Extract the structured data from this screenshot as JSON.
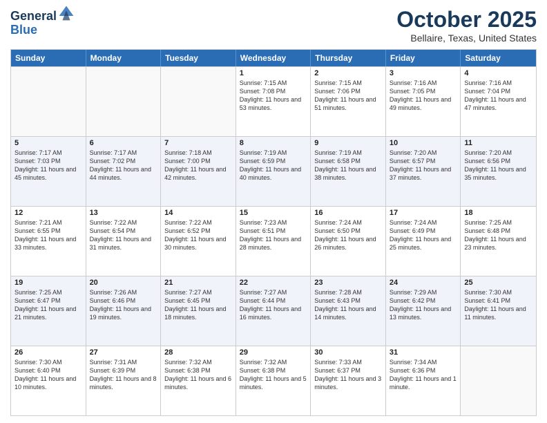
{
  "header": {
    "logo_line1": "General",
    "logo_line2": "Blue",
    "month": "October 2025",
    "location": "Bellaire, Texas, United States"
  },
  "weekdays": [
    "Sunday",
    "Monday",
    "Tuesday",
    "Wednesday",
    "Thursday",
    "Friday",
    "Saturday"
  ],
  "rows": [
    [
      {
        "day": "",
        "sunrise": "",
        "sunset": "",
        "daylight": ""
      },
      {
        "day": "",
        "sunrise": "",
        "sunset": "",
        "daylight": ""
      },
      {
        "day": "",
        "sunrise": "",
        "sunset": "",
        "daylight": ""
      },
      {
        "day": "1",
        "sunrise": "Sunrise: 7:15 AM",
        "sunset": "Sunset: 7:08 PM",
        "daylight": "Daylight: 11 hours and 53 minutes."
      },
      {
        "day": "2",
        "sunrise": "Sunrise: 7:15 AM",
        "sunset": "Sunset: 7:06 PM",
        "daylight": "Daylight: 11 hours and 51 minutes."
      },
      {
        "day": "3",
        "sunrise": "Sunrise: 7:16 AM",
        "sunset": "Sunset: 7:05 PM",
        "daylight": "Daylight: 11 hours and 49 minutes."
      },
      {
        "day": "4",
        "sunrise": "Sunrise: 7:16 AM",
        "sunset": "Sunset: 7:04 PM",
        "daylight": "Daylight: 11 hours and 47 minutes."
      }
    ],
    [
      {
        "day": "5",
        "sunrise": "Sunrise: 7:17 AM",
        "sunset": "Sunset: 7:03 PM",
        "daylight": "Daylight: 11 hours and 45 minutes."
      },
      {
        "day": "6",
        "sunrise": "Sunrise: 7:17 AM",
        "sunset": "Sunset: 7:02 PM",
        "daylight": "Daylight: 11 hours and 44 minutes."
      },
      {
        "day": "7",
        "sunrise": "Sunrise: 7:18 AM",
        "sunset": "Sunset: 7:00 PM",
        "daylight": "Daylight: 11 hours and 42 minutes."
      },
      {
        "day": "8",
        "sunrise": "Sunrise: 7:19 AM",
        "sunset": "Sunset: 6:59 PM",
        "daylight": "Daylight: 11 hours and 40 minutes."
      },
      {
        "day": "9",
        "sunrise": "Sunrise: 7:19 AM",
        "sunset": "Sunset: 6:58 PM",
        "daylight": "Daylight: 11 hours and 38 minutes."
      },
      {
        "day": "10",
        "sunrise": "Sunrise: 7:20 AM",
        "sunset": "Sunset: 6:57 PM",
        "daylight": "Daylight: 11 hours and 37 minutes."
      },
      {
        "day": "11",
        "sunrise": "Sunrise: 7:20 AM",
        "sunset": "Sunset: 6:56 PM",
        "daylight": "Daylight: 11 hours and 35 minutes."
      }
    ],
    [
      {
        "day": "12",
        "sunrise": "Sunrise: 7:21 AM",
        "sunset": "Sunset: 6:55 PM",
        "daylight": "Daylight: 11 hours and 33 minutes."
      },
      {
        "day": "13",
        "sunrise": "Sunrise: 7:22 AM",
        "sunset": "Sunset: 6:54 PM",
        "daylight": "Daylight: 11 hours and 31 minutes."
      },
      {
        "day": "14",
        "sunrise": "Sunrise: 7:22 AM",
        "sunset": "Sunset: 6:52 PM",
        "daylight": "Daylight: 11 hours and 30 minutes."
      },
      {
        "day": "15",
        "sunrise": "Sunrise: 7:23 AM",
        "sunset": "Sunset: 6:51 PM",
        "daylight": "Daylight: 11 hours and 28 minutes."
      },
      {
        "day": "16",
        "sunrise": "Sunrise: 7:24 AM",
        "sunset": "Sunset: 6:50 PM",
        "daylight": "Daylight: 11 hours and 26 minutes."
      },
      {
        "day": "17",
        "sunrise": "Sunrise: 7:24 AM",
        "sunset": "Sunset: 6:49 PM",
        "daylight": "Daylight: 11 hours and 25 minutes."
      },
      {
        "day": "18",
        "sunrise": "Sunrise: 7:25 AM",
        "sunset": "Sunset: 6:48 PM",
        "daylight": "Daylight: 11 hours and 23 minutes."
      }
    ],
    [
      {
        "day": "19",
        "sunrise": "Sunrise: 7:25 AM",
        "sunset": "Sunset: 6:47 PM",
        "daylight": "Daylight: 11 hours and 21 minutes."
      },
      {
        "day": "20",
        "sunrise": "Sunrise: 7:26 AM",
        "sunset": "Sunset: 6:46 PM",
        "daylight": "Daylight: 11 hours and 19 minutes."
      },
      {
        "day": "21",
        "sunrise": "Sunrise: 7:27 AM",
        "sunset": "Sunset: 6:45 PM",
        "daylight": "Daylight: 11 hours and 18 minutes."
      },
      {
        "day": "22",
        "sunrise": "Sunrise: 7:27 AM",
        "sunset": "Sunset: 6:44 PM",
        "daylight": "Daylight: 11 hours and 16 minutes."
      },
      {
        "day": "23",
        "sunrise": "Sunrise: 7:28 AM",
        "sunset": "Sunset: 6:43 PM",
        "daylight": "Daylight: 11 hours and 14 minutes."
      },
      {
        "day": "24",
        "sunrise": "Sunrise: 7:29 AM",
        "sunset": "Sunset: 6:42 PM",
        "daylight": "Daylight: 11 hours and 13 minutes."
      },
      {
        "day": "25",
        "sunrise": "Sunrise: 7:30 AM",
        "sunset": "Sunset: 6:41 PM",
        "daylight": "Daylight: 11 hours and 11 minutes."
      }
    ],
    [
      {
        "day": "26",
        "sunrise": "Sunrise: 7:30 AM",
        "sunset": "Sunset: 6:40 PM",
        "daylight": "Daylight: 11 hours and 10 minutes."
      },
      {
        "day": "27",
        "sunrise": "Sunrise: 7:31 AM",
        "sunset": "Sunset: 6:39 PM",
        "daylight": "Daylight: 11 hours and 8 minutes."
      },
      {
        "day": "28",
        "sunrise": "Sunrise: 7:32 AM",
        "sunset": "Sunset: 6:38 PM",
        "daylight": "Daylight: 11 hours and 6 minutes."
      },
      {
        "day": "29",
        "sunrise": "Sunrise: 7:32 AM",
        "sunset": "Sunset: 6:38 PM",
        "daylight": "Daylight: 11 hours and 5 minutes."
      },
      {
        "day": "30",
        "sunrise": "Sunrise: 7:33 AM",
        "sunset": "Sunset: 6:37 PM",
        "daylight": "Daylight: 11 hours and 3 minutes."
      },
      {
        "day": "31",
        "sunrise": "Sunrise: 7:34 AM",
        "sunset": "Sunset: 6:36 PM",
        "daylight": "Daylight: 11 hours and 1 minute."
      },
      {
        "day": "",
        "sunrise": "",
        "sunset": "",
        "daylight": ""
      }
    ]
  ]
}
